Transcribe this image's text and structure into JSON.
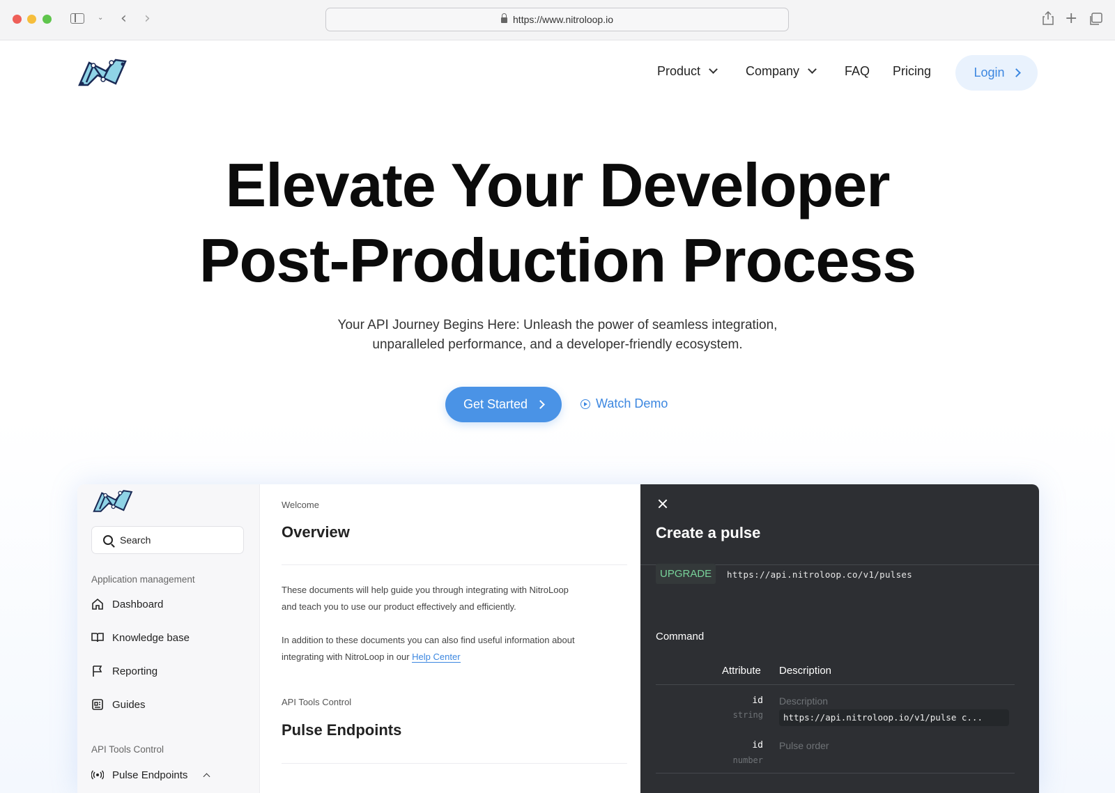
{
  "browser": {
    "url": "https://www.nitroloop.io"
  },
  "nav": {
    "items": [
      {
        "label": "Product",
        "dropdown": true
      },
      {
        "label": "Company",
        "dropdown": true
      },
      {
        "label": "FAQ",
        "dropdown": false
      },
      {
        "label": "Pricing",
        "dropdown": false
      }
    ],
    "login_label": "Login"
  },
  "hero": {
    "title_line1": "Elevate Your Developer",
    "title_line2": "Post-Production Process",
    "subtitle_line1": "Your API Journey Begins Here: Unleash the power of seamless integration,",
    "subtitle_line2": "unparalleled performance, and a developer-friendly ecosystem.",
    "cta_label": "Get Started",
    "demo_label": "Watch Demo"
  },
  "app": {
    "sidebar": {
      "search_placeholder": "Search",
      "section1_label": "Application management",
      "section1_items": [
        "Dashboard",
        "Knowledge base",
        "Reporting",
        "Guides"
      ],
      "section2_label": "API Tools Control",
      "section2_items": [
        "Pulse Endpoints"
      ]
    },
    "content": {
      "eyebrow": "Welcome",
      "title": "Overview",
      "p1_line1": "These documents will help guide you through integrating with NitroLoop",
      "p1_line2": "and teach you to use our product effectively and efficiently.",
      "p2_line1": "In addition to these documents you can also find useful information about",
      "p2_line2_prefix": "integrating with NitroLoop in our ",
      "help_link": "Help Center",
      "section_eyebrow": "API Tools Control",
      "section_title": "Pulse Endpoints"
    },
    "panel": {
      "title": "Create a pulse",
      "badge": "UPGRADE",
      "endpoint": "https://api.nitroloop.co/v1/pulses",
      "command_label": "Command",
      "col_attribute": "Attribute",
      "col_description": "Description",
      "rows": [
        {
          "attr": "id",
          "type": "string",
          "description": "Description",
          "code": "https://api.nitroloop.io/v1/pulse c..."
        },
        {
          "attr": "id",
          "type": "number",
          "description": "Pulse order"
        }
      ]
    }
  },
  "colors": {
    "accent": "#4a93e6",
    "link": "#3c87e0",
    "login_bg": "#e9f2fd",
    "panel_bg": "#2d2f33",
    "badge_text": "#78d29a"
  }
}
